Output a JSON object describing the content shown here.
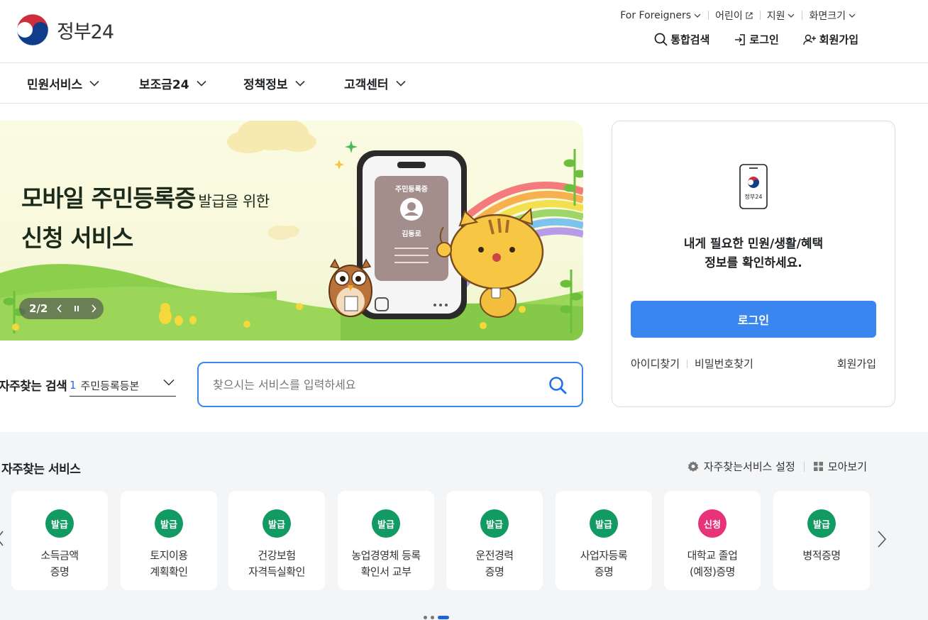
{
  "header": {
    "logo_text": "정부24",
    "util_links": [
      "For Foreigners",
      "어린이",
      "지원",
      "화면크기"
    ],
    "account": {
      "search": "통합검색",
      "login": "로그인",
      "signup": "회원가입"
    }
  },
  "gnb": [
    "민원서비스",
    "보조금24",
    "정책정보",
    "고객센터"
  ],
  "banner": {
    "title_line1": "모바일 주민등록증",
    "title_line1_small": "발급을 위한",
    "title_line2": "신청 서비스",
    "phone_card_title": "주민등록증",
    "phone_card_name": "김동로",
    "counter": "2/2"
  },
  "login_box": {
    "icon_label": "정부24",
    "message_line1": "내게 필요한 민원/생활/혜택",
    "message_line2": "정보를 확인하세요.",
    "login_button": "로그인",
    "find_id": "아이디찾기",
    "find_pw": "비밀번호찾기",
    "signup": "회원가입"
  },
  "search": {
    "fav_label": "자주찾는 검색",
    "fav_rank": "1",
    "fav_value": "주민등록등본",
    "placeholder": "찾으시는 서비스를 입력하세요"
  },
  "frequent": {
    "title": "자주찾는 서비스",
    "settings": "자주찾는서비스 설정",
    "view_all": "모아보기",
    "cards": [
      {
        "badge": "발급",
        "line1": "소득금액",
        "line2": "증명",
        "color": "#119a62"
      },
      {
        "badge": "발급",
        "line1": "토지이용",
        "line2": "계획확인",
        "color": "#119a62"
      },
      {
        "badge": "발급",
        "line1": "건강보험",
        "line2": "자격득실확인",
        "color": "#119a62"
      },
      {
        "badge": "발급",
        "line1": "농업경영체 등록",
        "line2": "확인서 교부",
        "color": "#119a62"
      },
      {
        "badge": "발급",
        "line1": "운전경력",
        "line2": "증명",
        "color": "#119a62"
      },
      {
        "badge": "발급",
        "line1": "사업자등록",
        "line2": "증명",
        "color": "#119a62"
      },
      {
        "badge": "신청",
        "line1": "대학교 졸업",
        "line2": "(예정)증명",
        "color": "#e8327a"
      },
      {
        "badge": "발급",
        "line1": "병적증명",
        "line2": "",
        "color": "#119a62"
      }
    ],
    "pagination_pages": 3,
    "pagination_active": 3
  },
  "colors": {
    "primary": "#3a86f0",
    "issue_badge": "#119a62",
    "apply_badge": "#e8327a",
    "background_gray": "#f3f5f7"
  }
}
